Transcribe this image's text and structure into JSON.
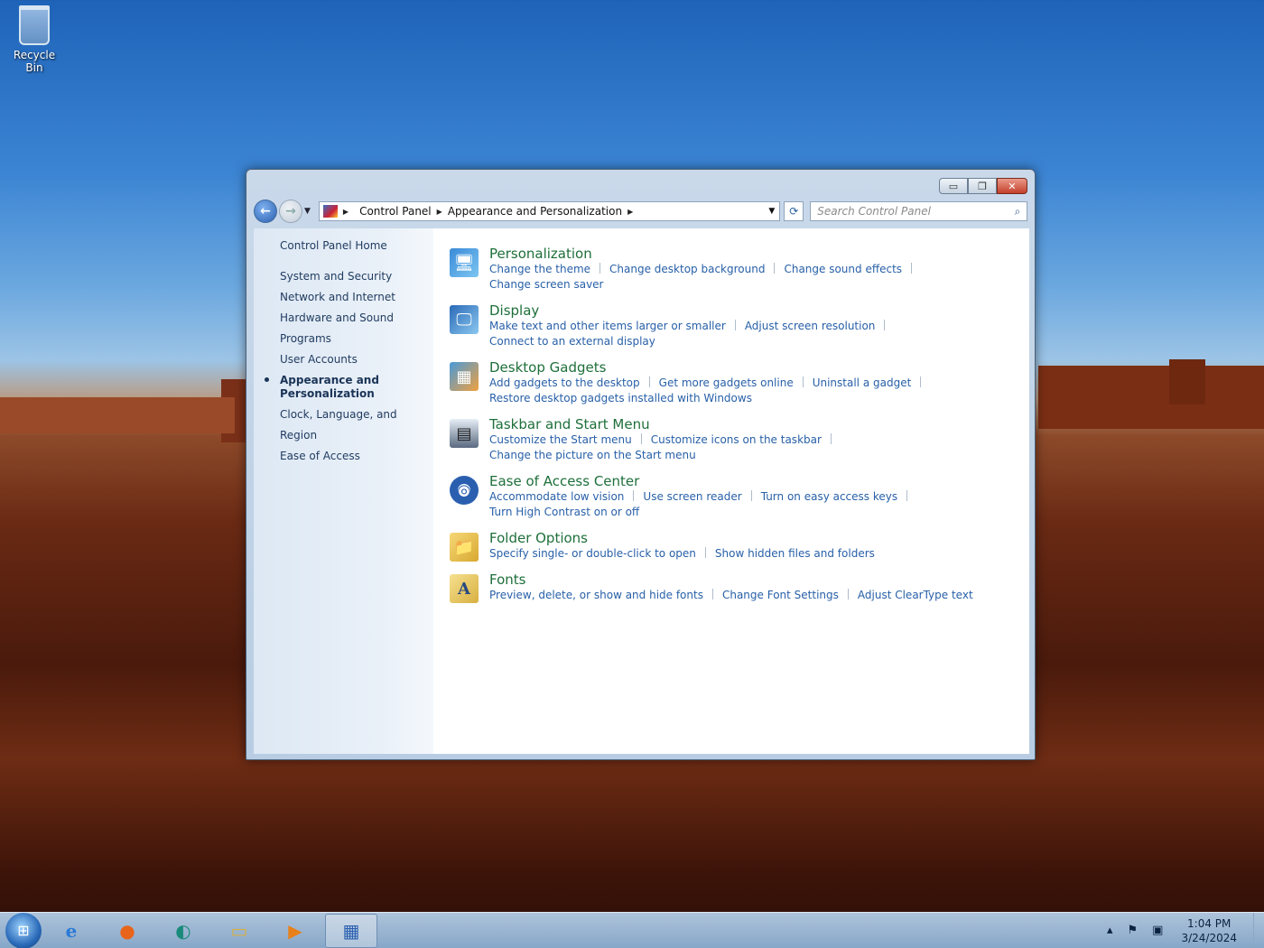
{
  "desktop": {
    "icons": [
      {
        "label": "Recycle Bin",
        "icon": "recycle-bin-icon"
      }
    ]
  },
  "window": {
    "buttons": {
      "minimize": "▭",
      "maximize": "❐",
      "close": "✕"
    },
    "address": {
      "segments": [
        "Control Panel",
        "Appearance and Personalization"
      ]
    },
    "search": {
      "placeholder": "Search Control Panel"
    },
    "left_pane": {
      "home": "Control Panel Home",
      "items": [
        "System and Security",
        "Network and Internet",
        "Hardware and Sound",
        "Programs",
        "User Accounts",
        "Appearance and Personalization",
        "Clock, Language, and Region",
        "Ease of Access"
      ],
      "active_index": 5
    },
    "categories": [
      {
        "title": "Personalization",
        "icon": "personalization-icon",
        "links": [
          "Change the theme",
          "Change desktop background",
          "Change sound effects",
          "Change screen saver"
        ]
      },
      {
        "title": "Display",
        "icon": "display-icon",
        "links": [
          "Make text and other items larger or smaller",
          "Adjust screen resolution",
          "Connect to an external display"
        ]
      },
      {
        "title": "Desktop Gadgets",
        "icon": "gadgets-icon",
        "links": [
          "Add gadgets to the desktop",
          "Get more gadgets online",
          "Uninstall a gadget",
          "Restore desktop gadgets installed with Windows"
        ]
      },
      {
        "title": "Taskbar and Start Menu",
        "icon": "taskbar-icon",
        "links": [
          "Customize the Start menu",
          "Customize icons on the taskbar",
          "Change the picture on the Start menu"
        ]
      },
      {
        "title": "Ease of Access Center",
        "icon": "ease-of-access-icon",
        "links": [
          "Accommodate low vision",
          "Use screen reader",
          "Turn on easy access keys",
          "Turn High Contrast on or off"
        ]
      },
      {
        "title": "Folder Options",
        "icon": "folder-options-icon",
        "links": [
          "Specify single- or double-click to open",
          "Show hidden files and folders"
        ]
      },
      {
        "title": "Fonts",
        "icon": "fonts-icon",
        "links": [
          "Preview, delete, or show and hide fonts",
          "Change Font Settings",
          "Adjust ClearType text"
        ]
      }
    ]
  },
  "taskbar": {
    "items": [
      "start-orb-icon",
      "internet-explorer-icon",
      "firefox-icon",
      "app-icon",
      "file-explorer-icon",
      "media-player-icon",
      "control-panel-icon"
    ],
    "clock": {
      "time": "1:04 PM",
      "date": "3/24/2024"
    }
  }
}
